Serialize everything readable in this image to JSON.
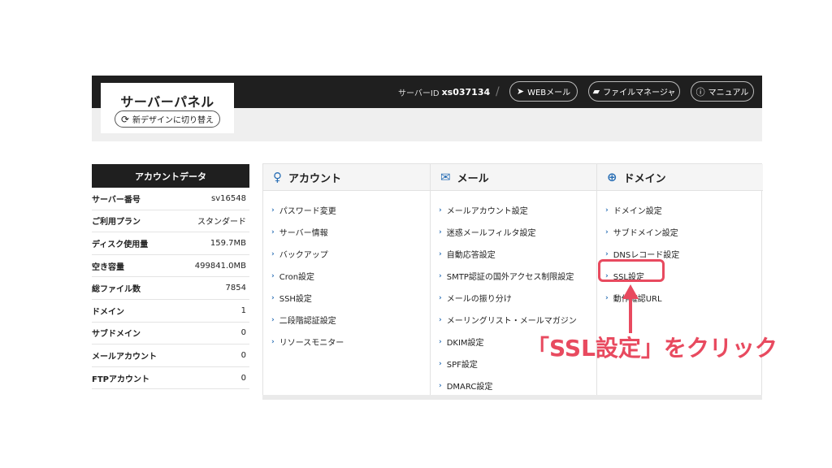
{
  "header": {
    "title": "サーバーパネル",
    "switch_design_label": "新デザインに切り替え",
    "server_id_label": "サーバーID",
    "server_id_value": "xs037134",
    "separator": "/",
    "buttons": [
      {
        "label": "WEBメール",
        "icon": "paper-plane-icon"
      },
      {
        "label": "ファイルマネージャ",
        "icon": "folder-icon"
      },
      {
        "label": "マニュアル",
        "icon": "question-icon"
      }
    ]
  },
  "account": {
    "title": "アカウントデータ",
    "rows": [
      {
        "key": "サーバー番号",
        "value": "sv16548"
      },
      {
        "key": "ご利用プラン",
        "value": "スタンダード"
      },
      {
        "key": "ディスク使用量",
        "value": "159.7MB"
      },
      {
        "key": "空き容量",
        "value": "499841.0MB"
      },
      {
        "key": "総ファイル数",
        "value": "7854"
      },
      {
        "key": "ドメイン",
        "value": "1"
      },
      {
        "key": "サブドメイン",
        "value": "0"
      },
      {
        "key": "メールアカウント",
        "value": "0"
      },
      {
        "key": "FTPアカウント",
        "value": "0"
      }
    ]
  },
  "columns": [
    {
      "title": "アカウント",
      "icon": "user-icon",
      "items": [
        "パスワード変更",
        "サーバー情報",
        "バックアップ",
        "Cron設定",
        "SSH設定",
        "二段階認証設定",
        "リソースモニター"
      ]
    },
    {
      "title": "メール",
      "icon": "envelope-icon",
      "items": [
        "メールアカウント設定",
        "迷惑メールフィルタ設定",
        "自動応答設定",
        "SMTP認証の国外アクセス制限設定",
        "メールの振り分け",
        "メーリングリスト・メールマガジン",
        "DKIM設定",
        "SPF設定",
        "DMARC設定"
      ]
    },
    {
      "title": "ドメイン",
      "icon": "globe-icon",
      "items": [
        "ドメイン設定",
        "サブドメイン設定",
        "DNSレコード設定",
        "SSL設定",
        "動作確認URL"
      ]
    }
  ],
  "annotation": {
    "callout": "「SSL設定」をクリック",
    "color": "#e84a5f"
  }
}
